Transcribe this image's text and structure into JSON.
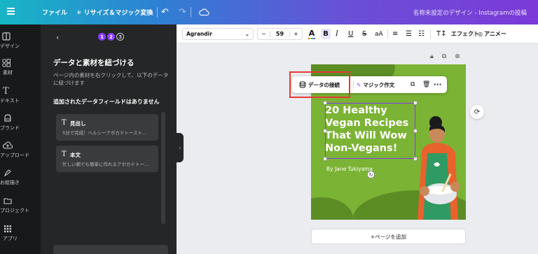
{
  "topbar": {
    "file_label": "ファイル",
    "resize_label": "✳ リサイズ＆マジック変換",
    "undo_icon": "undo-icon",
    "redo_icon": "redo-icon",
    "doc_title": "名称未設定のデザイン - Instagramの投稿"
  },
  "rail": {
    "items": [
      {
        "label": "デザイン",
        "icon": "layout-icon"
      },
      {
        "label": "素材",
        "icon": "elements-icon"
      },
      {
        "label": "テキスト",
        "icon": "text-icon"
      },
      {
        "label": "ブランド",
        "icon": "brand-icon"
      },
      {
        "label": "アップロード",
        "icon": "upload-icon"
      },
      {
        "label": "お絵描き",
        "icon": "draw-icon"
      },
      {
        "label": "プロジェクト",
        "icon": "folder-icon"
      },
      {
        "label": "アプリ",
        "icon": "apps-icon"
      }
    ]
  },
  "panel": {
    "steps": [
      "1",
      "2",
      "3"
    ],
    "title": "データと素材を紐づける",
    "description": "ページ内の素材を右クリックして、以下のデータに紐づけます",
    "subtitle": "追加されたデータフィールドはありません",
    "fields": [
      {
        "name": "見出し",
        "preview": "5分で完成！ヘルシーアボカドトースト..."
      },
      {
        "name": "本文",
        "preview": "忙しい朝でも簡単に作れるアボカドトー..."
      }
    ]
  },
  "format_toolbar": {
    "font": "Agrandir",
    "font_size": "59",
    "minus": "−",
    "plus": "+",
    "effect_label": "エフェクト",
    "animate_label": "アニメー"
  },
  "context_toolbar": {
    "data_label": "データの接続",
    "magic_label": "マジック作文"
  },
  "design": {
    "headline": "20 Healthy\nVegan Recipes\nThat Will Wow\nNon-Vegans!",
    "byline": "By Jane Tukiyama",
    "background_color": "#7bb334"
  },
  "canvas": {
    "add_page_label": "+ページを追加"
  }
}
